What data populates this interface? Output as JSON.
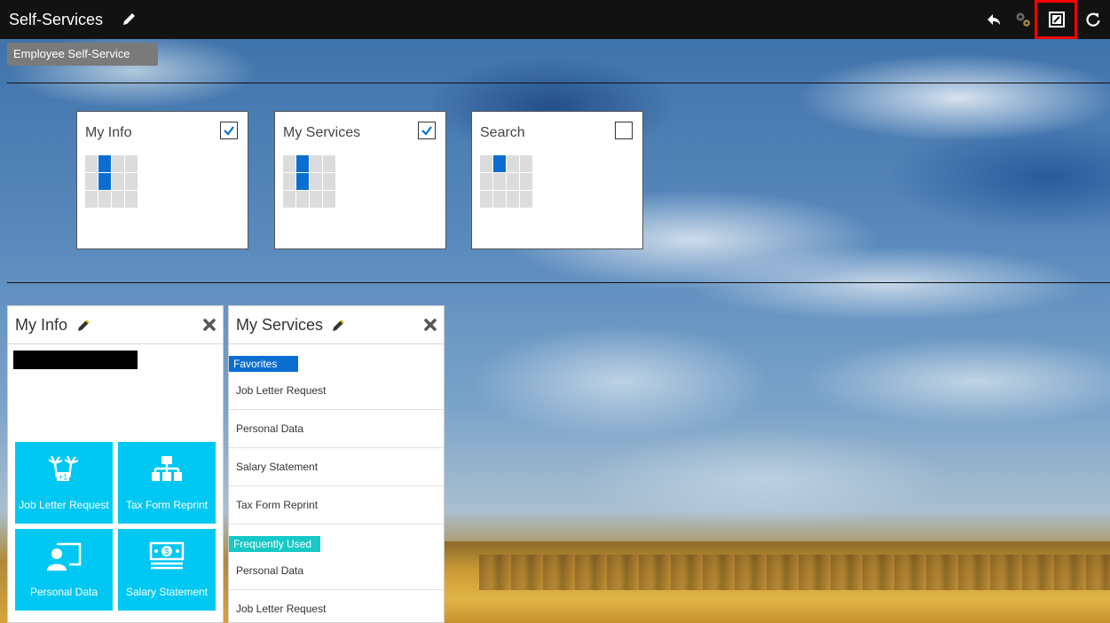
{
  "app": {
    "title": "Self-Services",
    "breadcrumb": "Employee Self-Service"
  },
  "toolbar": {
    "icons": [
      "back-icon",
      "gear-icon",
      "personalize-icon",
      "refresh-icon"
    ],
    "highlight_color": "#ff0000"
  },
  "config_tiles": [
    {
      "label": "My Info",
      "checked": true
    },
    {
      "label": "My Services",
      "checked": true
    },
    {
      "label": "Search",
      "checked": false
    }
  ],
  "my_info_panel": {
    "title": "My Info",
    "tiles": [
      {
        "label": "Job Letter Request",
        "icon": "palm-trees-icon"
      },
      {
        "label": "Tax Form Reprint",
        "icon": "org-chart-icon"
      },
      {
        "label": "Personal Data",
        "icon": "person-board-icon"
      },
      {
        "label": "Salary Statement",
        "icon": "money-bill-icon"
      }
    ]
  },
  "my_services_panel": {
    "title": "My Services",
    "favorites_label": "Favorites",
    "favorites": [
      "Job Letter Request",
      "Personal Data",
      "Salary Statement",
      "Tax Form Reprint"
    ],
    "frequently_used_label": "Frequently Used",
    "frequently_used": [
      "Personal Data",
      "Job Letter Request"
    ]
  },
  "colors": {
    "tile": "#00c8f2",
    "favorites_tag": "#0a6ed1",
    "frequently_used_tag": "#17c9c6",
    "topbar": "#121212"
  }
}
